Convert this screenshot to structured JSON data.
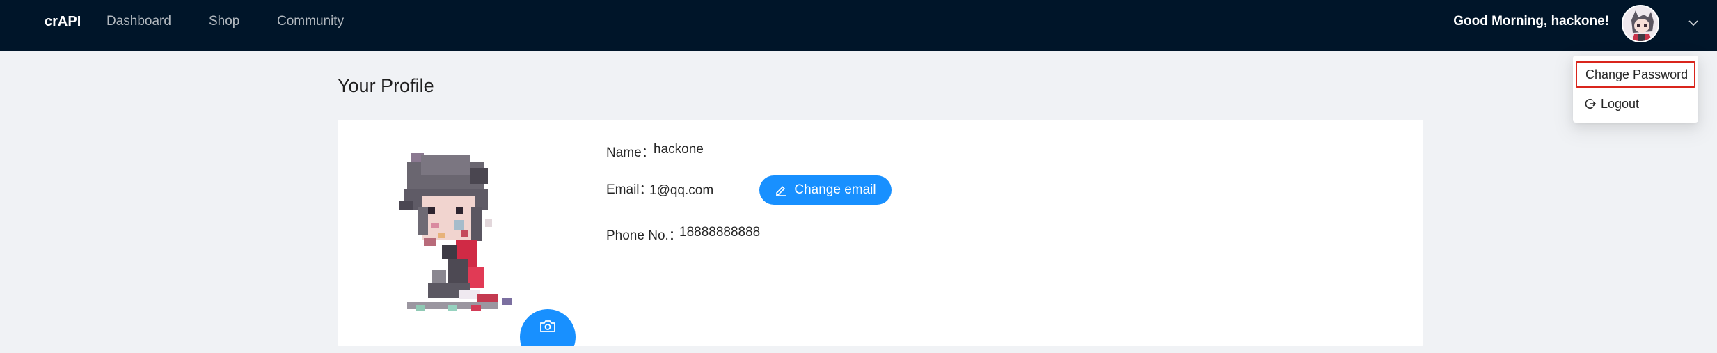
{
  "app": {
    "brand": "crAPI"
  },
  "nav": {
    "items": [
      "Dashboard",
      "Shop",
      "Community"
    ]
  },
  "user": {
    "greeting": "Good Morning, hackone!"
  },
  "dropdown": {
    "items": [
      {
        "label": "Change Password"
      },
      {
        "label": "Logout"
      }
    ]
  },
  "page": {
    "title": "Your Profile"
  },
  "profile": {
    "name_label": "Name：",
    "name_value": "hackone",
    "email_label": "Email：",
    "email_value": "1@qq.com",
    "change_email_label": "Change email",
    "phone_label": "Phone No.：",
    "phone_value": "18888888888"
  },
  "colors": {
    "header_bg": "#001529",
    "primary": "#1890ff",
    "highlight_border": "#d9251c",
    "page_bg": "#f0f2f5"
  },
  "icons": [
    "chevron-down-icon",
    "logout-icon",
    "edit-icon",
    "camera-icon",
    "avatar"
  ]
}
